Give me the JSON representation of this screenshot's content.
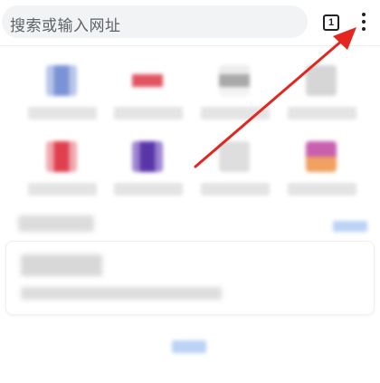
{
  "toolbar": {
    "search_placeholder": "搜索或输入网址",
    "tab_count": "1",
    "menu_icon": "more-vert-icon"
  },
  "shortcuts": [
    {
      "icon_color": "#7b93d6"
    },
    {
      "icon_color": "#e05560"
    },
    {
      "icon_color": "#a8a8a8"
    },
    {
      "icon_color": "#d6d6d6"
    },
    {
      "icon_color": "#e0404e"
    },
    {
      "icon_color": "#5a35a8"
    },
    {
      "icon_color": "#dedede"
    },
    {
      "icon_color": "#c860b0"
    }
  ],
  "colors": {
    "annotation_arrow": "#e3261f",
    "search_bg": "#f1f3f4",
    "link_blue": "#bcd3f5"
  }
}
